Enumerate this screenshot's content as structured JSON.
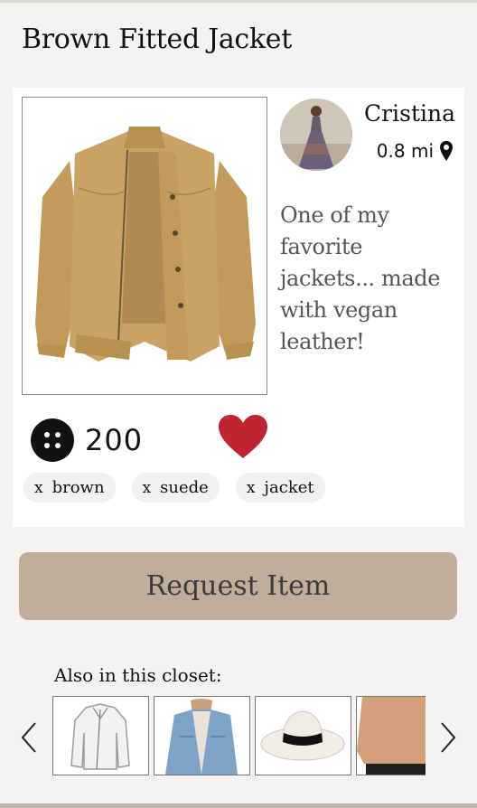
{
  "product": {
    "title": "Brown Fitted Jacket",
    "image_icon": "suede-jacket-image",
    "description": "One of my favorite jackets... made with vegan leather!",
    "points": "200",
    "tags": [
      {
        "x": "x",
        "label": "brown"
      },
      {
        "x": "x",
        "label": "suede"
      },
      {
        "x": "x",
        "label": "jacket"
      }
    ]
  },
  "seller": {
    "name": "Cristina",
    "distance": "0.8 mi",
    "avatar_icon": "seller-avatar-photo"
  },
  "actions": {
    "request_label": "Request Item",
    "like_icon": "heart-icon"
  },
  "closet": {
    "label": "Also in this closet:",
    "items": [
      {
        "icon": "white-leather-jacket-thumb"
      },
      {
        "icon": "denim-jacket-thumb"
      },
      {
        "icon": "white-hat-thumb"
      },
      {
        "icon": "tan-sweater-thumb"
      }
    ]
  },
  "colors": {
    "background": "#f4f3f2",
    "button": "#bfae9b",
    "heart": "#c0242e",
    "jacket": "#c9a265"
  }
}
